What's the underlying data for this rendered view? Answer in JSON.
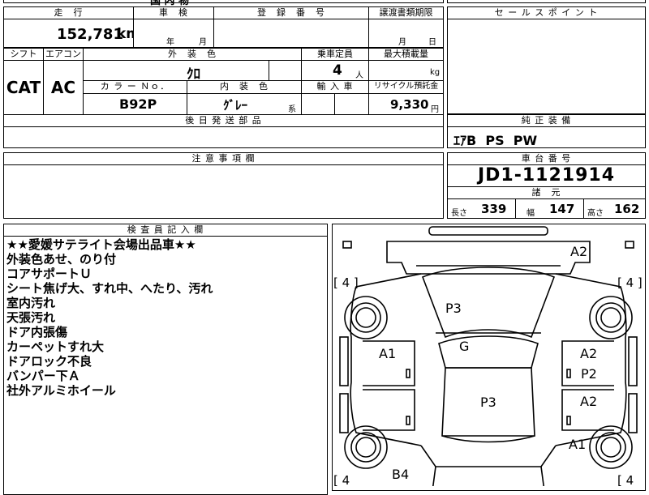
{
  "top_cut": {
    "text": "国 内 物"
  },
  "mileage": {
    "header": "走　行",
    "value": "152,781",
    "unit": "km"
  },
  "inspection": {
    "header": "車　検",
    "year_unit": "年",
    "month_unit": "月"
  },
  "registration": {
    "header": "登　録　番　号"
  },
  "transfer_deadline": {
    "header": "譲渡書類期限",
    "month_unit": "月",
    "day_unit": "日"
  },
  "sales_point": {
    "header": "セ ー ル ス ポ イ ン ト"
  },
  "shift": {
    "header": "シフト",
    "value": "CAT"
  },
  "aircon": {
    "header": "エアコン",
    "value": "AC"
  },
  "exterior_color": {
    "header": "外　装　色",
    "value": "ｸﾛ"
  },
  "capacity": {
    "header": "乗車定員",
    "value": "4",
    "unit": "人"
  },
  "max_load": {
    "header": "最大積載量",
    "unit": "kg"
  },
  "color_no": {
    "header": "カ ラ ー Ｎｏ．",
    "value": "B92P"
  },
  "interior_color": {
    "header": "内　装　色",
    "value": "ｸﾞﾚｰ",
    "suffix": "系"
  },
  "import": {
    "header": "輸 入 車"
  },
  "recycle": {
    "header": "リサイクル預託金",
    "value": "9,330",
    "unit": "円"
  },
  "later_parts": {
    "header": "後 日 発 送 部 品"
  },
  "genuine_equipment": {
    "header": "純 正 装 備",
    "value": "ｴｱB  PS  PW"
  },
  "cautions": {
    "header": "注 意 事 項 欄"
  },
  "chassis": {
    "header": "車 台 番 号",
    "value": "JD1-1121914"
  },
  "specs": {
    "header": "諸　元",
    "length_label": "長さ",
    "length": "339",
    "width_label": "幅",
    "width": "147",
    "height_label": "高さ",
    "height": "162"
  },
  "inspector": {
    "header": "検 査 員 記 入 欄",
    "notes": [
      "★★愛媛サテライト会場出品車★★",
      "外装色あせ、のり付",
      "コアサポートＵ",
      "シート焦げ大、すれ中、へたり、汚れ",
      "室内汚れ",
      "天張汚れ",
      "ドア内張傷",
      "カーペットすれ大",
      "ドアロック不良",
      "バンパー下Ａ",
      "社外アルミホイール"
    ]
  },
  "diagram": {
    "tire_left_top": "[ 4 ]",
    "tire_right_top": "[ 4 ]",
    "tire_left_bottom": "[ 4",
    "tire_right_bottom": "[ 4",
    "marks": {
      "front_right": "A2",
      "hood": "P3",
      "windshield": "G",
      "left_front_door": "A1",
      "right_front_door_a": "A2",
      "right_front_door_p": "P2",
      "roof": "P3",
      "right_rear_door": "A2",
      "right_rear": "A1",
      "rear_left": "B4"
    }
  }
}
